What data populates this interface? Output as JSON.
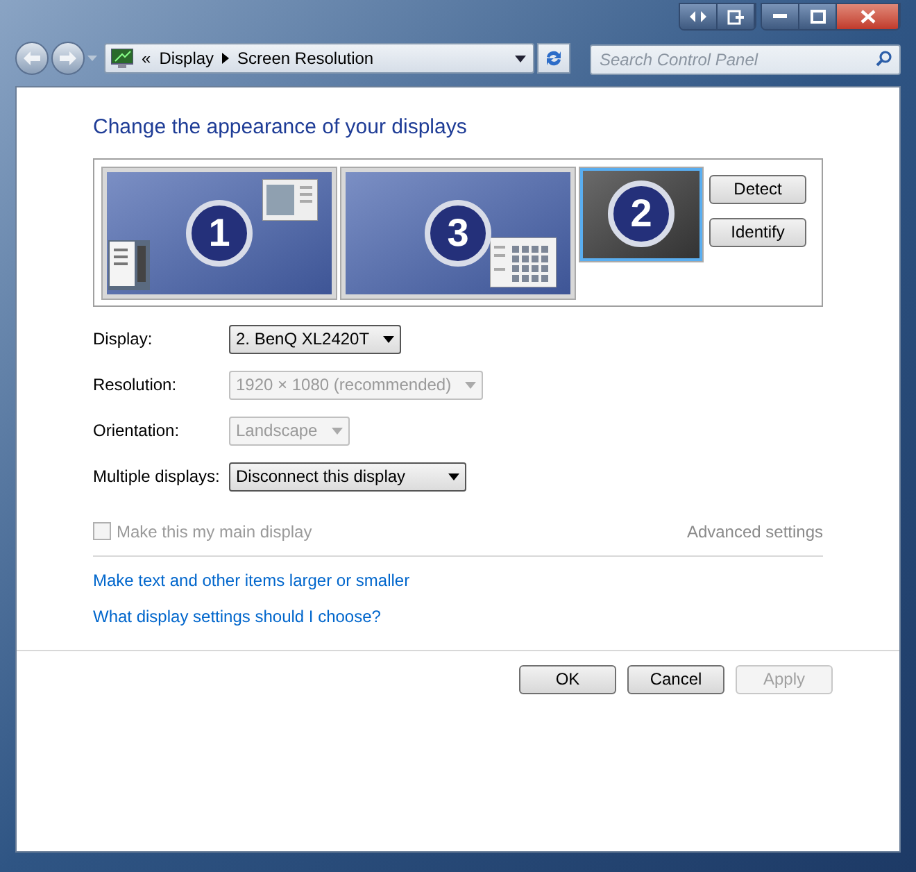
{
  "window": {
    "controls": [
      {
        "kind": "snap"
      },
      {
        "kind": "dock"
      },
      {
        "kind": "minimize"
      },
      {
        "kind": "maximize"
      },
      {
        "kind": "close"
      }
    ]
  },
  "address_bar": {
    "overflow": "«",
    "breadcrumbs": [
      "Display",
      "Screen Resolution"
    ]
  },
  "search": {
    "placeholder": "Search Control Panel"
  },
  "heading": "Change the appearance of your displays",
  "monitors": [
    {
      "label": "1",
      "selected": false,
      "active": true
    },
    {
      "label": "3",
      "selected": false,
      "active": true
    },
    {
      "label": "2",
      "selected": true,
      "active": false
    }
  ],
  "side_buttons": [
    "Detect",
    "Identify"
  ],
  "fields": [
    {
      "label": "Display:",
      "value": "2. BenQ XL2420T",
      "disabled": false
    },
    {
      "label": "Resolution:",
      "value": "1920 × 1080 (recommended)",
      "disabled": true
    },
    {
      "label": "Orientation:",
      "value": "Landscape",
      "disabled": true
    },
    {
      "label": "Multiple displays:",
      "value": "Disconnect this display",
      "disabled": false
    }
  ],
  "main_display_checkbox": {
    "label": "Make this my main display",
    "checked": false,
    "disabled": true
  },
  "advanced_link": {
    "label": "Advanced settings",
    "disabled": true
  },
  "links": [
    "Make text and other items larger or smaller",
    "What display settings should I choose?"
  ],
  "buttons": [
    {
      "label": "OK",
      "disabled": false
    },
    {
      "label": "Cancel",
      "disabled": false
    },
    {
      "label": "Apply",
      "disabled": true
    }
  ]
}
